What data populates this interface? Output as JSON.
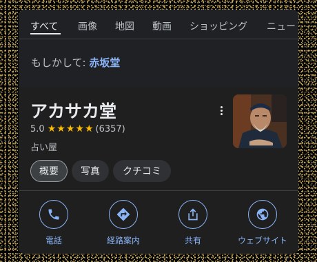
{
  "tabs": [
    "すべて",
    "画像",
    "地図",
    "動画",
    "ショッピング",
    "ニュー"
  ],
  "suggestion": {
    "prefix": "もしかして:",
    "term": "赤坂堂"
  },
  "place": {
    "name": "アカサカ堂",
    "rating": "5.0",
    "stars": 5,
    "review_count": "(6357)",
    "category": "占い屋"
  },
  "chips": [
    "概要",
    "写真",
    "クチコミ"
  ],
  "actions": [
    {
      "label": "電話",
      "icon": "phone-icon"
    },
    {
      "label": "経路案内",
      "icon": "directions-icon"
    },
    {
      "label": "共有",
      "icon": "share-icon"
    },
    {
      "label": "ウェブサイト",
      "icon": "globe-icon"
    }
  ],
  "colors": {
    "accent": "#8ab4f8",
    "star": "#fbbc04",
    "panel": "#202124"
  }
}
